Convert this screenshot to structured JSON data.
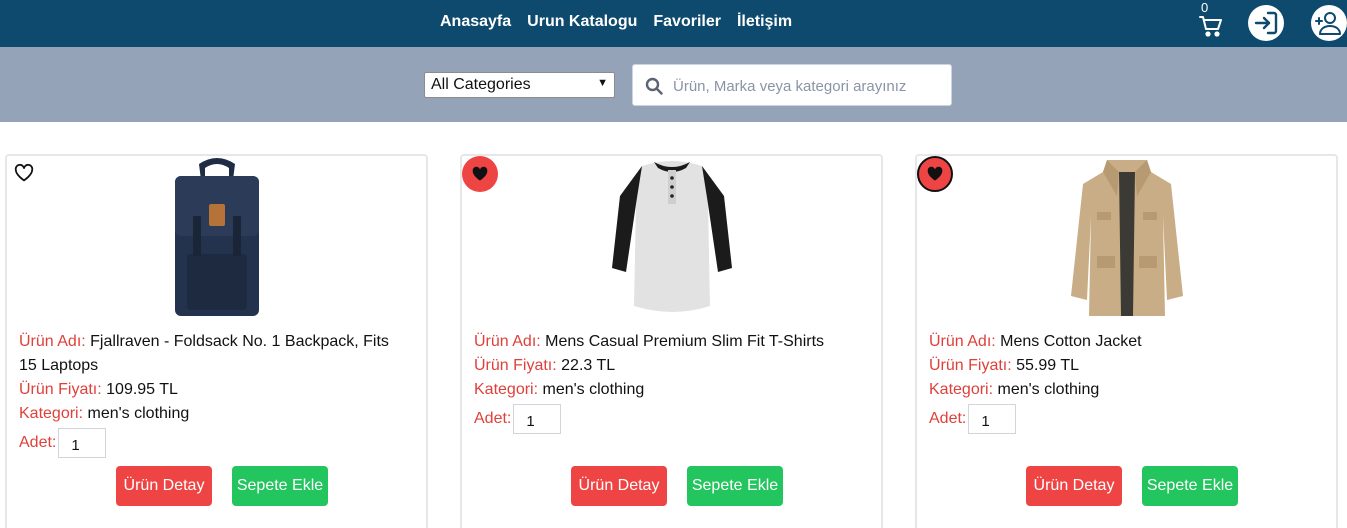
{
  "nav": {
    "links": [
      "Anasayfa",
      "Urun Katalogu",
      "Favoriler",
      "İletişim"
    ],
    "cart_count": "0"
  },
  "search": {
    "category_selected": "All Categories",
    "placeholder": "Ürün, Marka veya kategori arayınız"
  },
  "labels": {
    "name": "Ürün Adı:",
    "price": "Ürün Fiyatı:",
    "category": "Kategori:",
    "qty": "Adet:",
    "detail_button": "Ürün Detay",
    "add_button": "Sepete Ekle"
  },
  "products": [
    {
      "name": "Fjallraven - Foldsack No. 1 Backpack, Fits 15 Laptops",
      "price": "109.95 TL",
      "category": "men's clothing",
      "qty": "1",
      "favorite": false
    },
    {
      "name": "Mens Casual Premium Slim Fit T-Shirts",
      "price": "22.3 TL",
      "category": "men's clothing",
      "qty": "1",
      "favorite": true
    },
    {
      "name": "Mens Cotton Jacket",
      "price": "55.99 TL",
      "category": "men's clothing",
      "qty": "1",
      "favorite": true
    }
  ],
  "colors": {
    "nav_bg": "#0d4a6e",
    "search_band_bg": "#94a3b8",
    "label_red": "#e0403b",
    "detail_button": "#ef4444",
    "add_button": "#22c55e"
  },
  "icons": [
    "cart-icon",
    "login-icon",
    "user-add-icon",
    "search-icon",
    "heart-icon"
  ]
}
